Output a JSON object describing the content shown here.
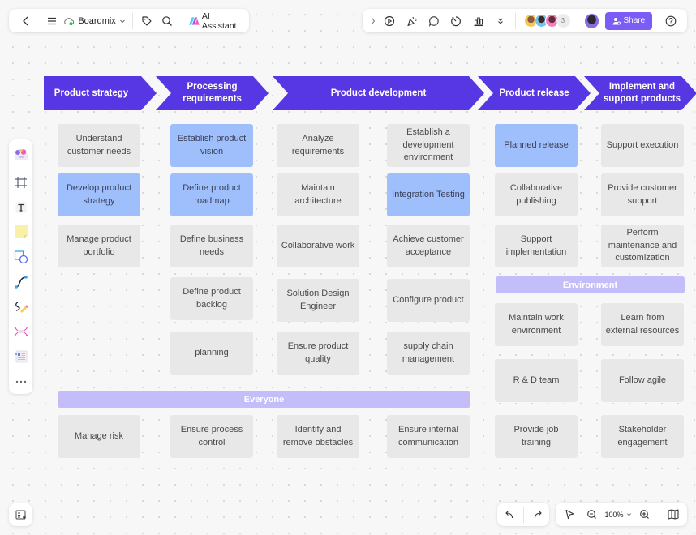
{
  "toolbar_left": {
    "back_label": "Back",
    "menu_label": "Menu",
    "board_name": "Boardmix",
    "ai_label": "AI Assistant"
  },
  "toolbar_right": {
    "avatar_extra_count": "3",
    "share_label": "Share"
  },
  "zoom": {
    "level": "100%"
  },
  "colors": {
    "stage_arrow": "#5637e3",
    "box_default": "#e8e8e9",
    "box_highlight": "#9fbffc",
    "group_bar": "#c3bdf9",
    "share_button": "#7b5cf5"
  },
  "stages": [
    {
      "label": "Product strategy"
    },
    {
      "label": "Processing requirements"
    },
    {
      "label": "Product development"
    },
    {
      "label": "Product release"
    },
    {
      "label": "Implement and support products"
    }
  ],
  "boxes": {
    "c1": [
      "Understand customer needs",
      "Develop product strategy",
      "Manage product portfolio"
    ],
    "c2": [
      "Establish product vision",
      "Define product roadmap",
      "Define business needs",
      "Define product backlog",
      "planning"
    ],
    "c3": [
      "Analyze requirements",
      "Maintain architecture",
      "Collaborative work",
      "Solution Design Engineer",
      "Ensure product quality"
    ],
    "c4": [
      "Establish a development environment",
      "Integration Testing",
      "Achieve customer acceptance",
      "Configure product",
      "supply chain management"
    ],
    "c5": [
      "Planned release",
      "Collaborative publishing",
      "Support implementation"
    ],
    "c6": [
      "Support execution",
      "Provide customer support",
      "Perform maintenance and customization"
    ]
  },
  "groups": {
    "everyone": {
      "label": "Everyone",
      "items": [
        "Manage risk",
        "Ensure process control",
        "Identify and remove obstacles",
        "Ensure internal communication"
      ]
    },
    "environment": {
      "label": "Environment",
      "items": [
        "Maintain work environment",
        "Learn from external resources",
        "R & D team",
        "Follow agile",
        "Provide job training",
        "Stakeholder engagement"
      ]
    }
  }
}
